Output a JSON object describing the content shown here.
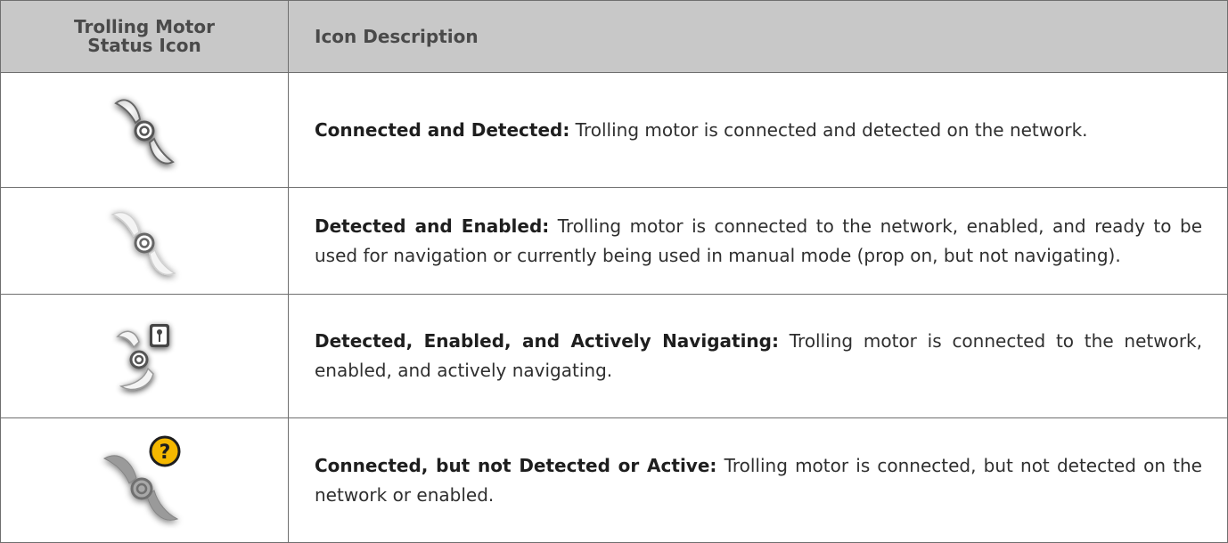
{
  "header": {
    "col1_line1": "Trolling Motor",
    "col1_line2": "Status Icon",
    "col2": "Icon Description"
  },
  "rows": [
    {
      "icon": "trolling-motor-connected-detected-icon",
      "title": "Connected and Detected:",
      "description": " Trolling motor is connected and detected on the network."
    },
    {
      "icon": "trolling-motor-detected-enabled-icon",
      "title": "Detected and Enabled:",
      "description": " Trolling motor is connected to the network, enabled, and ready to be used for navigation or currently being used in manual mode (prop on, but not navigating)."
    },
    {
      "icon": "trolling-motor-actively-navigating-icon",
      "title": "Detected, Enabled, and Actively Navigating:",
      "description": " Trolling motor is connected to the network, enabled, and actively navigating."
    },
    {
      "icon": "trolling-motor-not-detected-icon",
      "title": "Connected, but not Detected or Active:",
      "description": " Trolling motor is connected, but not detected on the network or enabled.",
      "badge": "?"
    }
  ]
}
